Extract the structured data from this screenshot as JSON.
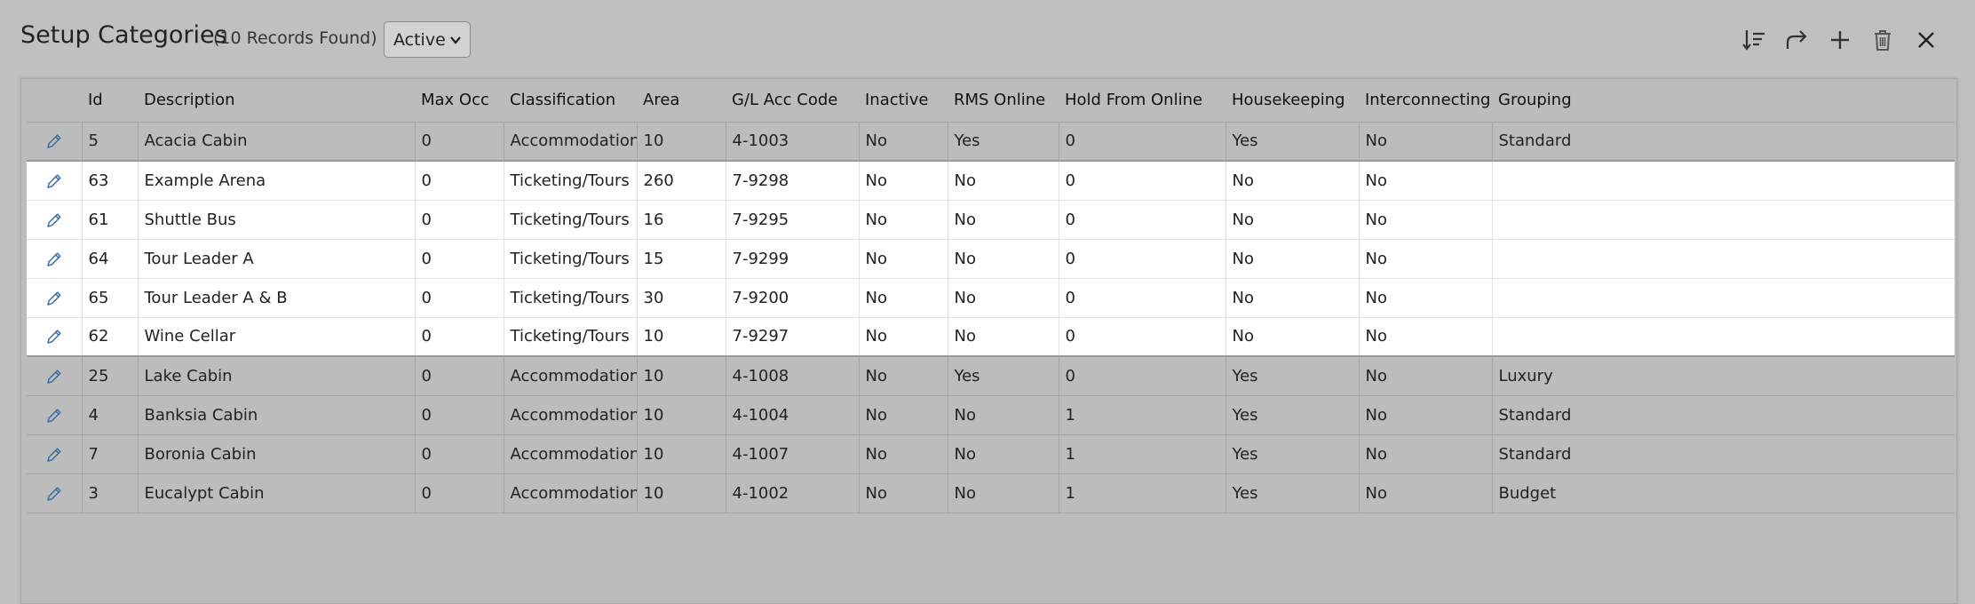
{
  "header": {
    "title": "Setup Categories",
    "record_count": "(10 Records Found)",
    "status_filter": "Active"
  },
  "toolbar": {
    "sort_icon": "sort-icon",
    "forward_icon": "share-forward-icon",
    "add_icon": "plus-icon",
    "delete_icon": "trash-icon",
    "close_icon": "close-icon"
  },
  "colors": {
    "background": "#c0c0c0",
    "selected_row": "#ffffff",
    "edit_icon": "#3a6ea5"
  },
  "table": {
    "columns": [
      "",
      "Id",
      "Description",
      "Max Occ",
      "Classification",
      "Area",
      "G/L Acc Code",
      "Inactive",
      "RMS Online",
      "Hold From Online",
      "Housekeeping",
      "Interconnecting",
      "Grouping"
    ],
    "rows": [
      {
        "id": "5",
        "description": "Acacia Cabin",
        "max_occ": "0",
        "classification": "Accommodation",
        "area": "10",
        "gl": "4-1003",
        "inactive": "No",
        "rms_online": "Yes",
        "hold": "0",
        "housekeeping": "Yes",
        "interconnecting": "No",
        "grouping": "Standard",
        "selected": false
      },
      {
        "id": "63",
        "description": "Example Arena",
        "max_occ": "0",
        "classification": "Ticketing/Tours",
        "area": "260",
        "gl": "7-9298",
        "inactive": "No",
        "rms_online": "No",
        "hold": "0",
        "housekeeping": "No",
        "interconnecting": "No",
        "grouping": "",
        "selected": true
      },
      {
        "id": "61",
        "description": "Shuttle Bus",
        "max_occ": "0",
        "classification": "Ticketing/Tours",
        "area": "16",
        "gl": "7-9295",
        "inactive": "No",
        "rms_online": "No",
        "hold": "0",
        "housekeeping": "No",
        "interconnecting": "No",
        "grouping": "",
        "selected": true
      },
      {
        "id": "64",
        "description": "Tour Leader A",
        "max_occ": "0",
        "classification": "Ticketing/Tours",
        "area": "15",
        "gl": "7-9299",
        "inactive": "No",
        "rms_online": "No",
        "hold": "0",
        "housekeeping": "No",
        "interconnecting": "No",
        "grouping": "",
        "selected": true
      },
      {
        "id": "65",
        "description": "Tour Leader A & B",
        "max_occ": "0",
        "classification": "Ticketing/Tours",
        "area": "30",
        "gl": "7-9200",
        "inactive": "No",
        "rms_online": "No",
        "hold": "0",
        "housekeeping": "No",
        "interconnecting": "No",
        "grouping": "",
        "selected": true
      },
      {
        "id": "62",
        "description": "Wine Cellar",
        "max_occ": "0",
        "classification": "Ticketing/Tours",
        "area": "10",
        "gl": "7-9297",
        "inactive": "No",
        "rms_online": "No",
        "hold": "0",
        "housekeeping": "No",
        "interconnecting": "No",
        "grouping": "",
        "selected": true
      },
      {
        "id": "25",
        "description": "Lake Cabin",
        "max_occ": "0",
        "classification": "Accommodation",
        "area": "10",
        "gl": "4-1008",
        "inactive": "No",
        "rms_online": "Yes",
        "hold": "0",
        "housekeeping": "Yes",
        "interconnecting": "No",
        "grouping": "Luxury",
        "selected": false
      },
      {
        "id": "4",
        "description": "Banksia Cabin",
        "max_occ": "0",
        "classification": "Accommodation",
        "area": "10",
        "gl": "4-1004",
        "inactive": "No",
        "rms_online": "No",
        "hold": "1",
        "housekeeping": "Yes",
        "interconnecting": "No",
        "grouping": "Standard",
        "selected": false
      },
      {
        "id": "7",
        "description": "Boronia Cabin",
        "max_occ": "0",
        "classification": "Accommodation",
        "area": "10",
        "gl": "4-1007",
        "inactive": "No",
        "rms_online": "No",
        "hold": "1",
        "housekeeping": "Yes",
        "interconnecting": "No",
        "grouping": "Standard",
        "selected": false
      },
      {
        "id": "3",
        "description": "Eucalypt Cabin",
        "max_occ": "0",
        "classification": "Accommodation",
        "area": "10",
        "gl": "4-1002",
        "inactive": "No",
        "rms_online": "No",
        "hold": "1",
        "housekeeping": "Yes",
        "interconnecting": "No",
        "grouping": "Budget",
        "selected": false
      }
    ]
  }
}
